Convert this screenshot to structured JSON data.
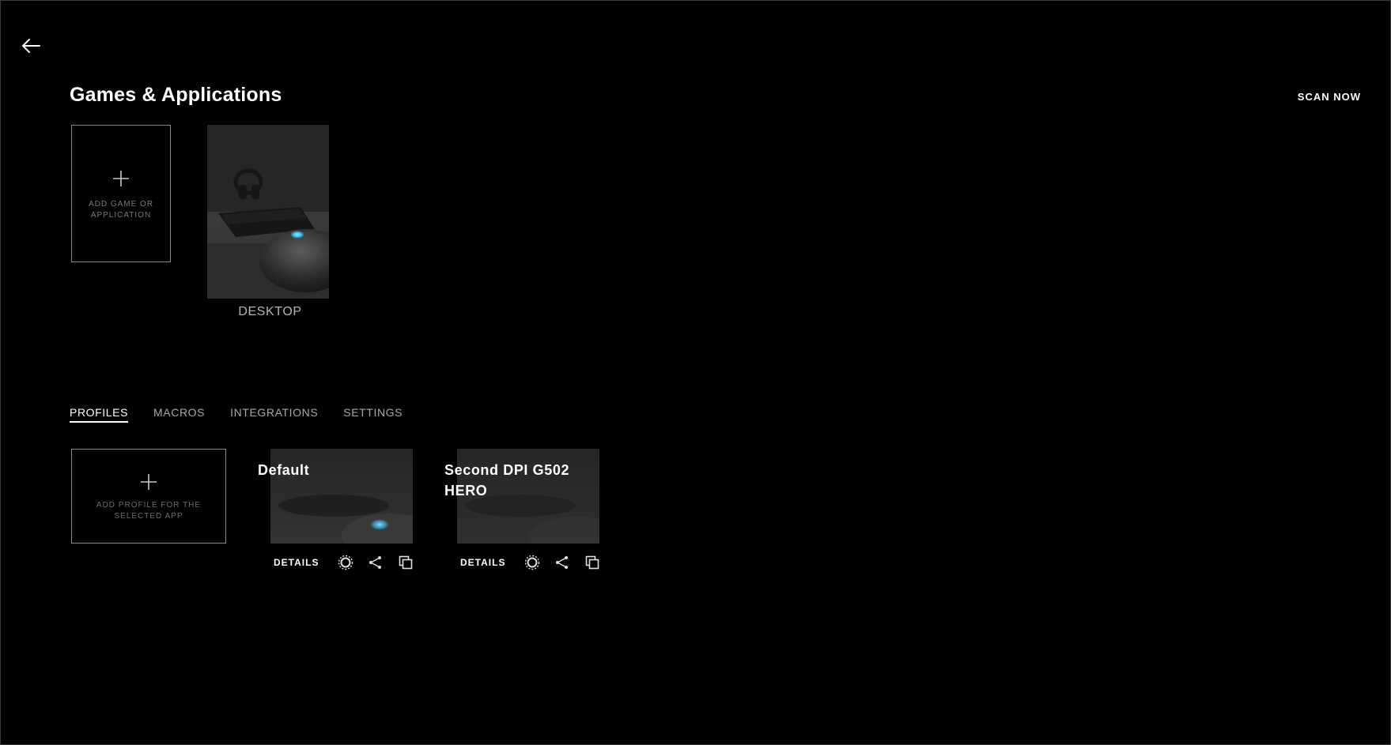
{
  "window": {
    "back_icon": "arrow-left-icon"
  },
  "header": {
    "title": "Games & Applications",
    "scan_now_label": "SCAN NOW"
  },
  "apps": {
    "add_label": "ADD GAME OR APPLICATION",
    "items": [
      {
        "name": "DESKTOP",
        "image": "desktop-mouse-keyboard-photo"
      }
    ]
  },
  "tabs": [
    {
      "label": "PROFILES",
      "active": true
    },
    {
      "label": "MACROS",
      "active": false
    },
    {
      "label": "INTEGRATIONS",
      "active": false
    },
    {
      "label": "SETTINGS",
      "active": false
    }
  ],
  "profiles": {
    "add_label": "ADD PROFILE FOR THE SELECTED APP",
    "items": [
      {
        "name": "Default",
        "details_label": "DETAILS",
        "icons": [
          "active-profile-icon",
          "share-icon",
          "copy-icon"
        ]
      },
      {
        "name": "Second DPI G502 HERO",
        "details_label": "DETAILS",
        "icons": [
          "active-profile-icon",
          "share-icon",
          "copy-icon"
        ]
      }
    ]
  },
  "colors": {
    "background": "#000000",
    "accent_glow": "#3ec8ff"
  }
}
